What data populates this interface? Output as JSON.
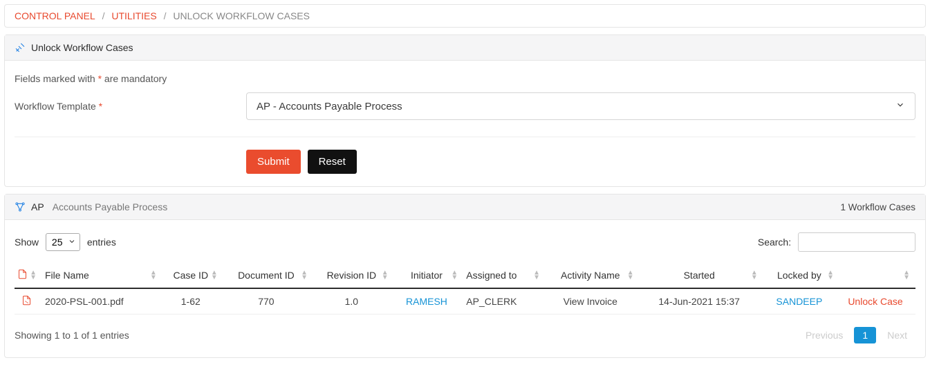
{
  "breadcrumb": {
    "control_panel": "CONTROL PANEL",
    "utilities": "UTILITIES",
    "current": "UNLOCK WORKFLOW CASES",
    "sep": "/"
  },
  "form_panel": {
    "title": "Unlock Workflow Cases",
    "mandatory_note_prefix": "Fields marked with ",
    "mandatory_note_star": "*",
    "mandatory_note_suffix": " are mandatory",
    "template_label": "Workflow Template ",
    "template_star": "*",
    "template_value": "AP - Accounts Payable Process",
    "submit_label": "Submit",
    "reset_label": "Reset"
  },
  "table_panel": {
    "header_code": "AP",
    "header_name": "Accounts Payable Process",
    "count_text": "1 Workflow Cases",
    "show_label_pre": "Show",
    "show_value": "25",
    "show_label_post": "entries",
    "search_label": "Search:",
    "columns": {
      "file_name": "File Name",
      "case_id": "Case ID",
      "document_id": "Document ID",
      "revision_id": "Revision ID",
      "initiator": "Initiator",
      "assigned_to": "Assigned to",
      "activity_name": "Activity Name",
      "started": "Started",
      "locked_by": "Locked by"
    },
    "rows": [
      {
        "file_name": "2020-PSL-001.pdf",
        "case_id": "1-62",
        "document_id": "770",
        "revision_id": "1.0",
        "initiator": "RAMESH",
        "assigned_to": "AP_CLERK",
        "activity_name": "View Invoice",
        "started": "14-Jun-2021 15:37",
        "locked_by": "SANDEEP",
        "action": "Unlock Case"
      }
    ],
    "footer_info": "Showing 1 to 1 of 1 entries",
    "pager": {
      "prev": "Previous",
      "page1": "1",
      "next": "Next"
    }
  }
}
